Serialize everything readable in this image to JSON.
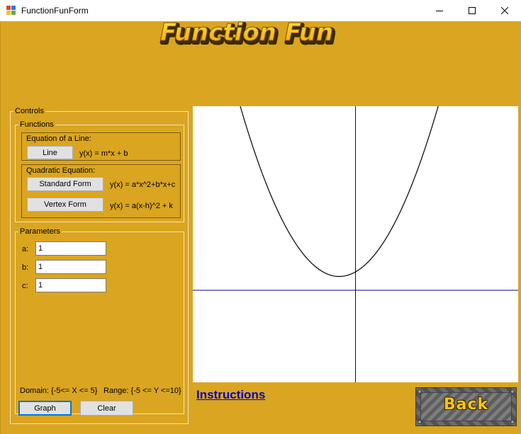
{
  "window": {
    "title": "FunctionFunForm"
  },
  "header": {
    "logo_text": "Function Fun"
  },
  "controls": {
    "title": "Controls",
    "functions": {
      "title": "Functions",
      "line_group": {
        "title": "Equation of a Line:",
        "button": "Line",
        "formula": "y(x) = m*x + b"
      },
      "quadratic_group": {
        "title": "Quadratic Equation:",
        "standard_button": "Standard Form",
        "standard_formula": "y(x) = a*x^2+b*x+c",
        "vertex_button": "Vertex Form",
        "vertex_formula": "y(x) = a(x-h)^2 + k"
      }
    },
    "parameters": {
      "title": "Parameters",
      "fields": [
        {
          "label": "a:",
          "value": "1"
        },
        {
          "label": "b:",
          "value": "1"
        },
        {
          "label": "c:",
          "value": "1"
        }
      ]
    },
    "domain_text": "Domain: {-5<= X <= 5}",
    "range_text": "Range: {-5 <= Y <=10}",
    "graph_button": "Graph",
    "clear_button": "Clear"
  },
  "instructions_link": "Instructions",
  "back_button": "Back",
  "colors": {
    "background": "#DAA520",
    "axis": "#00008B",
    "curve": "#000000",
    "link": "#0000CD"
  },
  "chart_data": {
    "type": "line",
    "function": "y = x^2 + x + 1",
    "xlim": [
      -5,
      5
    ],
    "ylim": [
      -5,
      10
    ],
    "vertex": [
      -0.5,
      0.75
    ]
  }
}
